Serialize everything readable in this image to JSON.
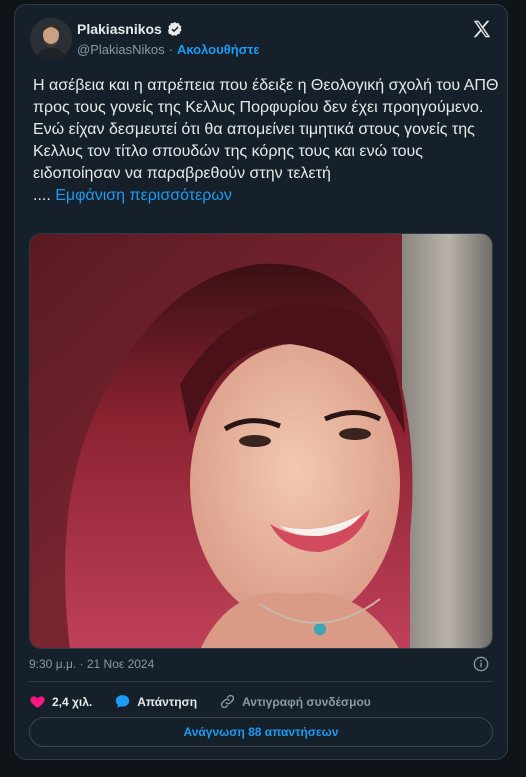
{
  "author": {
    "name": "Plakiasnikos",
    "handle": "@PlakiasNikos",
    "separator": "·",
    "follow_label": "Ακολουθήστε"
  },
  "tweet": {
    "text": "Η ασέβεια και η απρέπεια που έδειξε η Θεολογική σχολή του ΑΠΘ προς τους γονείς της Κελλυς Πορφυρίου δεν έχει προηγούμενο.\nΕνώ είχαν δεσμευτεί ότι θα απομείνει τιμητικά στους γονείς της Κελλυς τον τίτλο σπουδών της κόρης τους και ενώ τους ειδοποίησαν να παραβρεθούν στην τελετή\n.... ",
    "show_more": "Εμφάνιση περισσότερων"
  },
  "meta": {
    "time": "9:30 μ.μ.",
    "separator": "·",
    "date": "21 Νοε 2024"
  },
  "actions": {
    "like_count": "2,4 χιλ.",
    "reply_label": "Απάντηση",
    "copy_link_label": "Αντιγραφή συνδέσμου"
  },
  "read_replies_label": "Ανάγνωση 88 απαντήσεων",
  "colors": {
    "accent": "#1d9bf0",
    "like": "#f91880",
    "card_bg": "#15202b"
  },
  "icons": [
    "verified-icon",
    "x-logo-icon",
    "info-icon",
    "heart-icon",
    "reply-bubble-icon",
    "link-icon"
  ]
}
